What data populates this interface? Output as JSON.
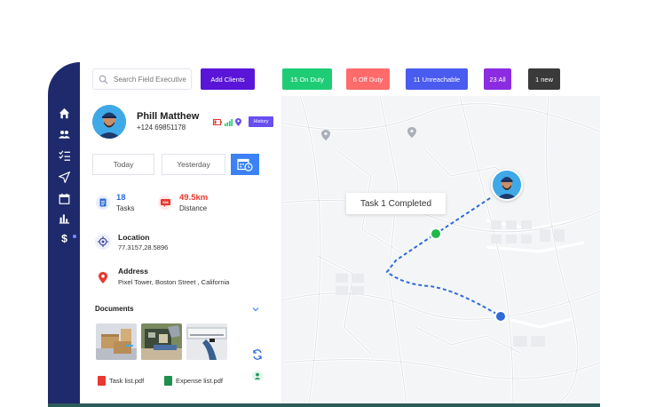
{
  "search": {
    "placeholder": "Search Field Executive"
  },
  "toolbar": {
    "add_clients": "Add Clients",
    "stats": {
      "on_duty": "15 On Duty",
      "off_duty": "6 Off Duty",
      "unreachable": "11 Unreachable",
      "all": "23 All",
      "new": "1 new"
    }
  },
  "profile": {
    "name": "Phill Matthew",
    "phone": "+124 69851178",
    "history_label": "History"
  },
  "tabs": {
    "today": "Today",
    "yesterday": "Yesterday"
  },
  "metrics": {
    "tasks_value": "18",
    "tasks_label": "Tasks",
    "distance_value": "49.5km",
    "distance_label": "Distance",
    "distance_badge": "KM"
  },
  "location": {
    "title": "Location",
    "value": "77.3157,28.5896"
  },
  "address": {
    "title": "Address",
    "value": "Pixel Tower, Boston Street , California"
  },
  "documents": {
    "title": "Documents",
    "files": [
      {
        "name": "Task list.pdf"
      },
      {
        "name": "Expense list.pdf"
      }
    ]
  },
  "map": {
    "tooltip": "Task 1 Completed"
  },
  "colors": {
    "sidebar": "#1f2a6d",
    "accent_purple": "#5a15d9",
    "on_duty": "#1fcc76",
    "off_duty": "#ff6b6b",
    "unreachable": "#4a5bf0",
    "all": "#8b2be2",
    "new": "#3a3a3a",
    "route": "#2f6bd9",
    "waypoint": "#1fb84a"
  }
}
